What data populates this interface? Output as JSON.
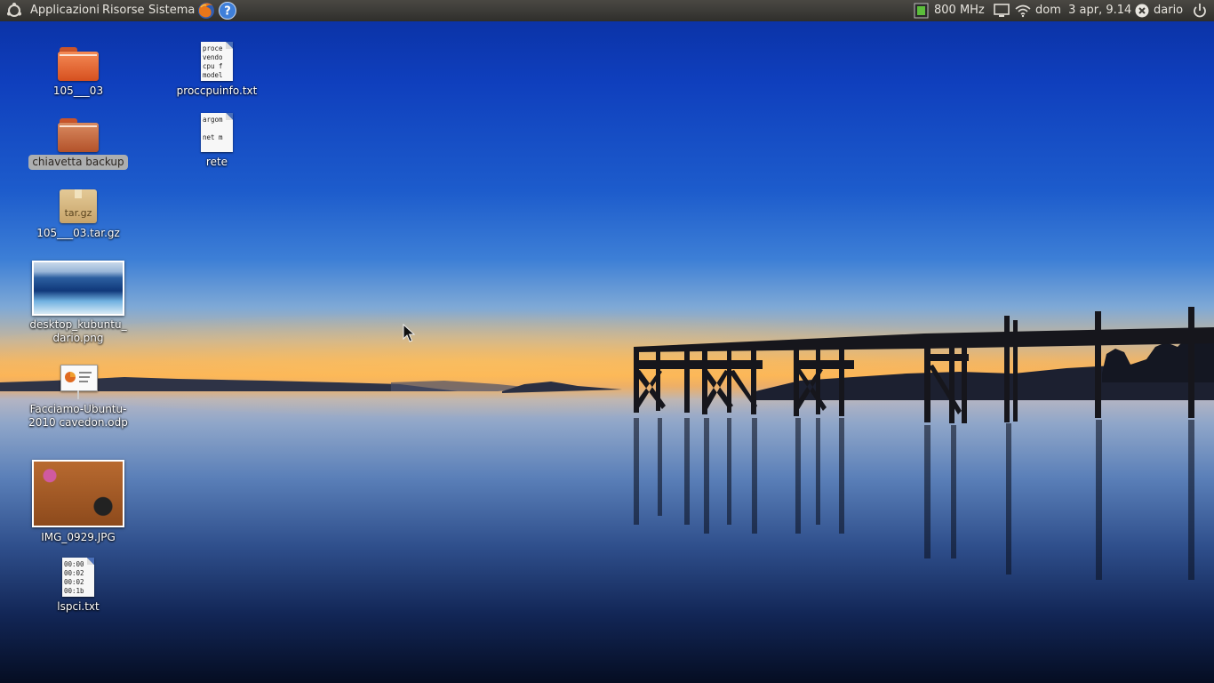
{
  "panel": {
    "menus": [
      "Applicazioni",
      "Risorse",
      "Sistema"
    ],
    "cpu_freq": "800 MHz",
    "clock": "dom  3 apr, 9.14",
    "user": "dario"
  },
  "desktop_icons": {
    "folder_1": "105___03",
    "folder_2": "chiavetta backup",
    "archive": "105___03.tar.gz",
    "archive_badge": "tar.gz",
    "screenshot": "desktop_kubuntu_\ndario.png",
    "presentation": "Facciamo-Ubuntu-\n2010 cavedon.odp",
    "photo": "IMG_0929.JPG",
    "lspci": "lspci.txt",
    "lspci_preview": "00:00\n00:02\n00:02\n00:1b",
    "proccpuinfo": "proccpuinfo.txt",
    "proccpuinfo_preview": "proce\nvendo\ncpu f\nmodel",
    "rete": "rete",
    "rete_preview": "argom\n\nnet m"
  },
  "colors": {
    "panel_bg": "#3c3b37",
    "folder_orange": "#e86a35",
    "selection": "#c8beaa"
  },
  "icons": [
    "ubuntu-logo-icon",
    "firefox-icon",
    "help-icon",
    "cpu-icon",
    "monitor-icon",
    "wifi-icon",
    "close-session-icon",
    "power-icon",
    "mouse-pointer-icon"
  ]
}
